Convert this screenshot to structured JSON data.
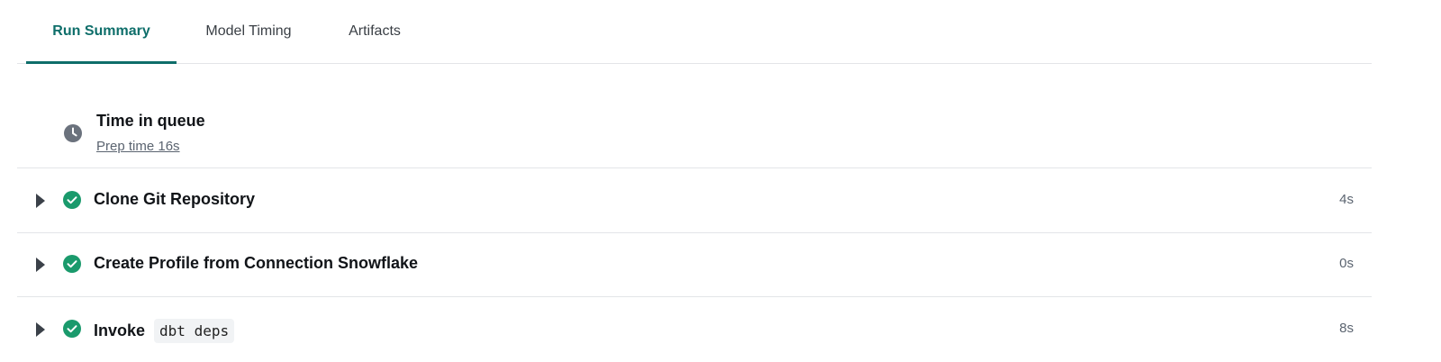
{
  "tabs": [
    {
      "label": "Run Summary",
      "active": true
    },
    {
      "label": "Model Timing",
      "active": false
    },
    {
      "label": "Artifacts",
      "active": false
    }
  ],
  "queue": {
    "title": "Time in queue",
    "subtitle": "Prep time 16s",
    "icon": "clock-icon"
  },
  "steps": [
    {
      "title": "Clone Git Repository",
      "duration": "4s",
      "status": "success"
    },
    {
      "title": "Create Profile from Connection Snowflake",
      "duration": "0s",
      "status": "success"
    },
    {
      "title": "Invoke",
      "code": "dbt deps",
      "duration": "8s",
      "status": "success"
    }
  ],
  "colors": {
    "accent": "#0e6e6a",
    "success": "#1a9a6c",
    "clock": "#6b727d"
  }
}
